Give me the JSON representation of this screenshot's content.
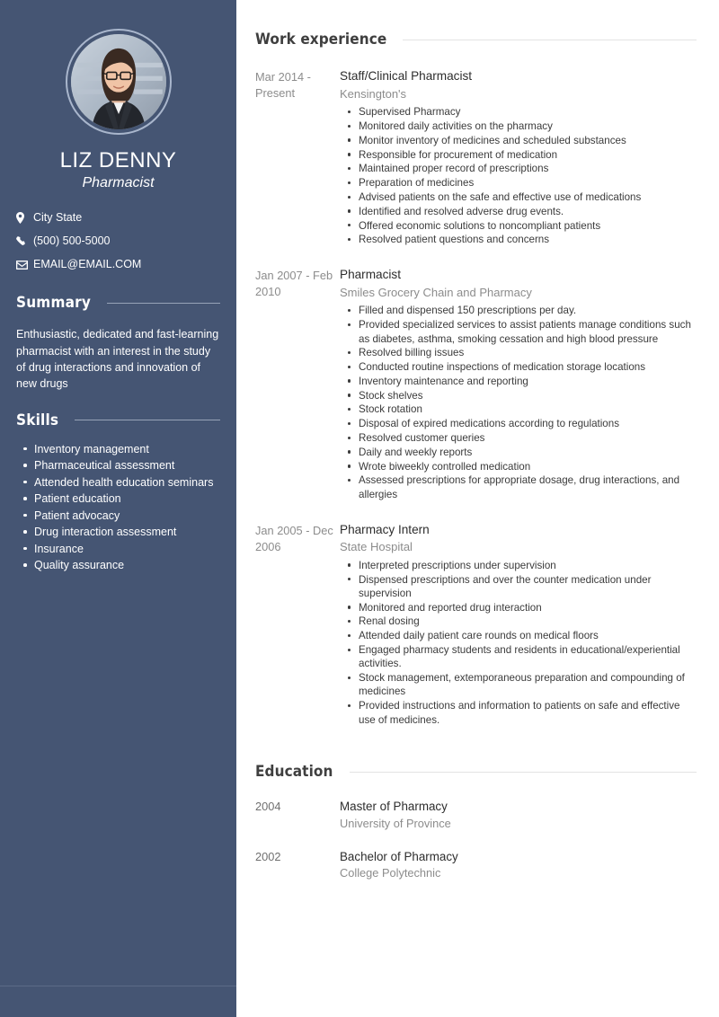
{
  "colors": {
    "sidebar_bg": "#455573",
    "sidebar_text": "#ffffff",
    "sidebar_rule": "#97a3b8",
    "main_bg": "#ffffff",
    "heading": "#3f3f3f",
    "muted": "#8c8c8c",
    "body_text": "#3b3b3b",
    "main_rule": "#e3e3e3"
  },
  "sidebar": {
    "photo_alt": "portrait-photo",
    "name": "LIZ DENNY",
    "job_title": "Pharmacist",
    "contacts": [
      {
        "icon": "location-pin-icon",
        "text": "City State"
      },
      {
        "icon": "phone-icon",
        "text": "(500) 500-5000"
      },
      {
        "icon": "envelope-icon",
        "text": "EMAIL@EMAIL.COM"
      }
    ],
    "summary": {
      "heading": "Summary",
      "text": "Enthusiastic, dedicated and fast-learning pharmacist with an interest in the study of drug interactions and innovation of new drugs"
    },
    "skills": {
      "heading": "Skills",
      "items": [
        "Inventory management",
        "Pharmaceutical assessment",
        "Attended health education seminars",
        "Patient education",
        "Patient advocacy",
        "Drug interaction assessment",
        "Insurance",
        "Quality assurance"
      ]
    }
  },
  "main": {
    "work": {
      "heading": "Work experience",
      "entries": [
        {
          "dates": "Mar 2014 - Present",
          "role": "Staff/Clinical Pharmacist",
          "org": "Kensington's",
          "duties": [
            "Supervised Pharmacy",
            "Monitored daily activities on the pharmacy",
            "Monitor inventory of medicines and scheduled substances",
            "Responsible for procurement of medication",
            "Maintained proper record of prescriptions",
            "Preparation of medicines",
            "Advised patients on the safe and effective use of  medications",
            "Identified and resolved adverse drug events.",
            "Offered economic solutions to noncompliant patients",
            "Resolved patient questions and concerns"
          ]
        },
        {
          "dates": "Jan 2007 - Feb 2010",
          "role": "Pharmacist",
          "org": "Smiles Grocery Chain and Pharmacy",
          "duties": [
            "Filled and dispensed 150 prescriptions per day.",
            "Provided specialized services to assist patients manage conditions such as diabetes, asthma, smoking cessation and high blood pressure",
            "Resolved billing issues",
            "Conducted routine inspections of medication storage locations",
            "Inventory maintenance and reporting",
            "Stock shelves",
            "Stock rotation",
            "Disposal of expired medications according to regulations",
            "Resolved customer queries",
            "Daily and weekly reports",
            "Wrote biweekly controlled medication",
            "Assessed prescriptions for appropriate dosage, drug interactions, and allergies"
          ]
        },
        {
          "dates": "Jan 2005 - Dec 2006",
          "role": "Pharmacy Intern",
          "org": "State Hospital",
          "duties": [
            "Interpreted prescriptions under supervision",
            "Dispensed prescriptions and over the counter medication under supervision",
            "Monitored and reported drug interaction",
            "Renal dosing",
            "Attended daily patient care rounds on medical floors",
            "Engaged pharmacy students and residents in educational/experiential activities.",
            "Stock management, extemporaneous preparation and compounding of medicines",
            "Provided instructions and information to patients on safe and effective use of medicines."
          ]
        }
      ]
    },
    "education": {
      "heading": "Education",
      "entries": [
        {
          "dates": "2004",
          "degree": "Master of Pharmacy",
          "school": "University of Province"
        },
        {
          "dates": "2002",
          "degree": "Bachelor of Pharmacy",
          "school": "College Polytechnic"
        }
      ]
    }
  }
}
